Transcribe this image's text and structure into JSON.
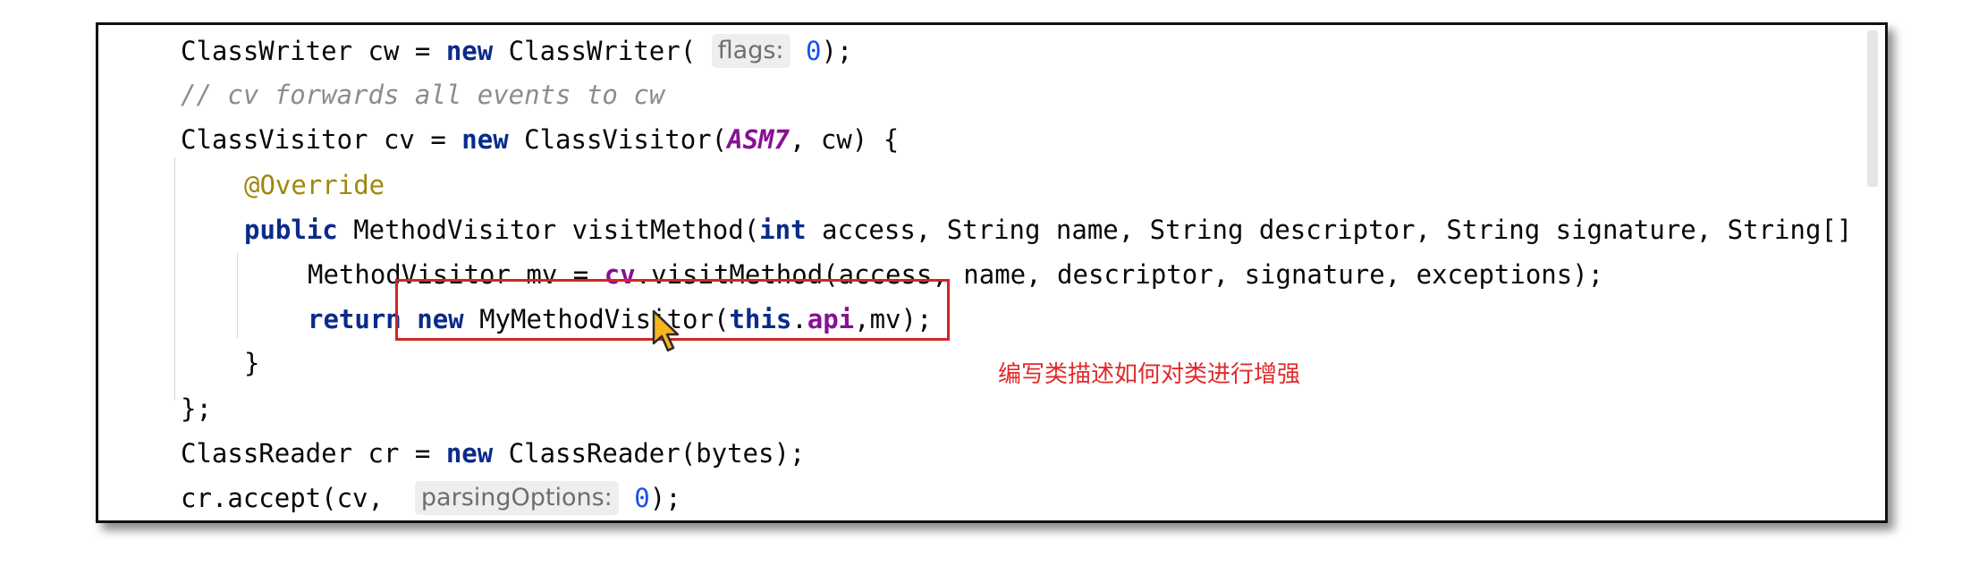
{
  "editor": {
    "lines": [
      {
        "parts": [
          {
            "t": "ClassWriter cw = "
          },
          {
            "t": "new",
            "c": "kw"
          },
          {
            "t": " ClassWriter( "
          },
          {
            "t": "flags:",
            "c": "hint"
          },
          {
            "t": " "
          },
          {
            "t": "0",
            "c": "num"
          },
          {
            "t": ");"
          }
        ]
      },
      {
        "parts": [
          {
            "t": "// cv forwards all events to cw",
            "c": "cmt"
          }
        ]
      },
      {
        "parts": [
          {
            "t": "ClassVisitor cv = "
          },
          {
            "t": "new",
            "c": "kw"
          },
          {
            "t": " ClassVisitor("
          },
          {
            "t": "ASM7",
            "c": "const"
          },
          {
            "t": ", cw) {"
          }
        ]
      },
      {
        "parts": [
          {
            "t": "@Override",
            "c": "ann"
          }
        ]
      },
      {
        "parts": [
          {
            "t": "public",
            "c": "kw"
          },
          {
            "t": " MethodVisitor visitMethod("
          },
          {
            "t": "int",
            "c": "kw"
          },
          {
            "t": " access, String name, String descriptor, String signature, String[]"
          }
        ]
      },
      {
        "parts": [
          {
            "t": "MethodVisitor mv = "
          },
          {
            "t": "cv",
            "c": "field"
          },
          {
            "t": ".visitMethod(access, name, descriptor, signature, exceptions);"
          }
        ]
      },
      {
        "parts": [
          {
            "t": "return",
            "c": "kw"
          },
          {
            "t": " "
          },
          {
            "t": "new",
            "c": "kw"
          },
          {
            "t": " MyMethodVisitor("
          },
          {
            "t": "this",
            "c": "kw"
          },
          {
            "t": "."
          },
          {
            "t": "api",
            "c": "field"
          },
          {
            "t": ",mv);"
          }
        ]
      },
      {
        "parts": [
          {
            "t": "}"
          }
        ]
      },
      {
        "parts": [
          {
            "t": "};"
          }
        ]
      },
      {
        "parts": [
          {
            "t": "ClassReader cr = "
          },
          {
            "t": "new",
            "c": "kw"
          },
          {
            "t": " ClassReader(bytes);"
          }
        ]
      },
      {
        "parts": [
          {
            "t": "cr.accept(cv,  "
          },
          {
            "t": "parsingOptions:",
            "c": "hint"
          },
          {
            "t": " "
          },
          {
            "t": "0",
            "c": "num"
          },
          {
            "t": ");"
          }
        ]
      }
    ]
  },
  "annotation": {
    "caption": "编写类描述如何对类进行增强",
    "highlight_color": "#d42424",
    "caption_color": "#e02a2a"
  },
  "icons": {
    "cursor": "mouse-pointer-icon"
  }
}
